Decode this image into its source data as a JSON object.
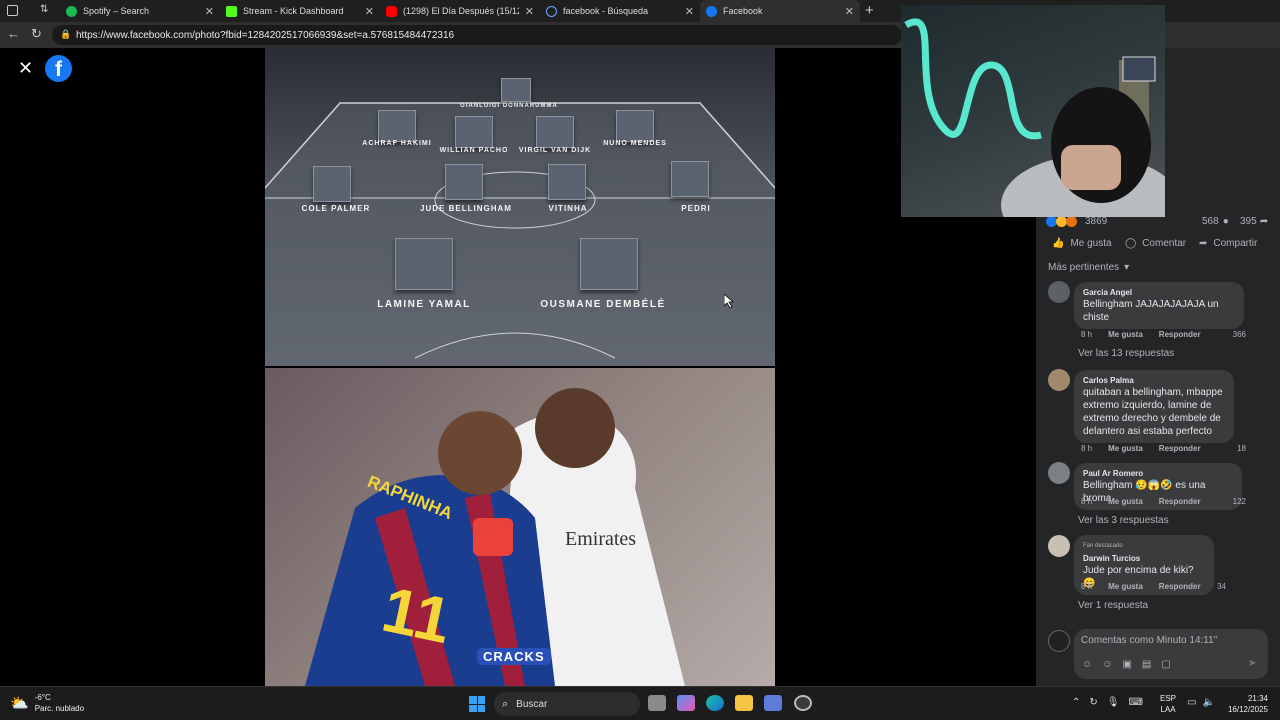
{
  "tabs": [
    {
      "label": "Spotify – Search",
      "color": "#1db954"
    },
    {
      "label": "Stream - Kick Dashboard",
      "color": "#53fc18"
    },
    {
      "label": "(1298) El Día Después (15/12/20...",
      "color": "#ff0000"
    },
    {
      "label": "facebook - Búsqueda",
      "color": "#6ea8fe"
    },
    {
      "label": "Facebook",
      "color": "#1877f2"
    }
  ],
  "url": "https://www.facebook.com/photo?fbid=1284202517066939&set=a.576815484472316",
  "photo": {
    "goalkeeper": "GIANLUIGI DONNARUMMA",
    "defenders": [
      "ACHRAF HAKIMI",
      "WILLIAN PACHO",
      "VIRGIL VAN DIJK",
      "NUNO MENDES"
    ],
    "midfielders": [
      "COLE PALMER",
      "JUDE BELLINGHAM",
      "VITINHA",
      "PEDRI"
    ],
    "forwards": [
      "LAMINE YAMAL",
      "OUSMANE DEMBÉLÉ"
    ],
    "jersey_left": "RAPHINHA",
    "jersey_number": "11",
    "jersey_right": "Emirates",
    "watermark": "CRACKS"
  },
  "reactions": {
    "count": "3869",
    "comments": "568",
    "shares": "395"
  },
  "actions": {
    "like": "Me gusta",
    "comment": "Comentar",
    "share": "Compartir"
  },
  "filter": "Más pertinentes",
  "comments": [
    {
      "author": "Garcia Angel",
      "text": "Bellingham JAJAJAJAJAJA un chiste",
      "time": "8 h",
      "like": "Me gusta",
      "reply": "Responder",
      "count": "366",
      "replies": "Ver las 13 respuestas"
    },
    {
      "author": "Carlos Palma",
      "text": "quitaban a bellingham, mbappe extremo izquierdo, lamine de extremo derecho y dembele de delantero asi estaba perfecto",
      "time": "8 h",
      "like": "Me gusta",
      "reply": "Responder",
      "count": "18",
      "replies": ""
    },
    {
      "author": "Paul Ar Romero",
      "text": "Bellingham 😥😱🤣 es una broma",
      "time": "8 h",
      "like": "Me gusta",
      "reply": "Responder",
      "count": "122",
      "replies": "Ver las 3 respuestas"
    },
    {
      "badge": "Fan destacado",
      "author": "Darwin Turcios",
      "text": "Jude por encima de kiki? 😄",
      "time": "8 h",
      "like": "Me gusta",
      "reply": "Responder",
      "count": "34",
      "replies": "Ver 1 respuesta"
    }
  ],
  "composer": {
    "placeholder": "Comentas como Minuto 14:11\""
  },
  "taskbar": {
    "weather_temp": "-6°C",
    "weather_desc": "Parc. nublado",
    "search": "Buscar",
    "lang1": "ESP",
    "lang2": "LAA",
    "time": "21:34",
    "date": "16/12/2025"
  }
}
